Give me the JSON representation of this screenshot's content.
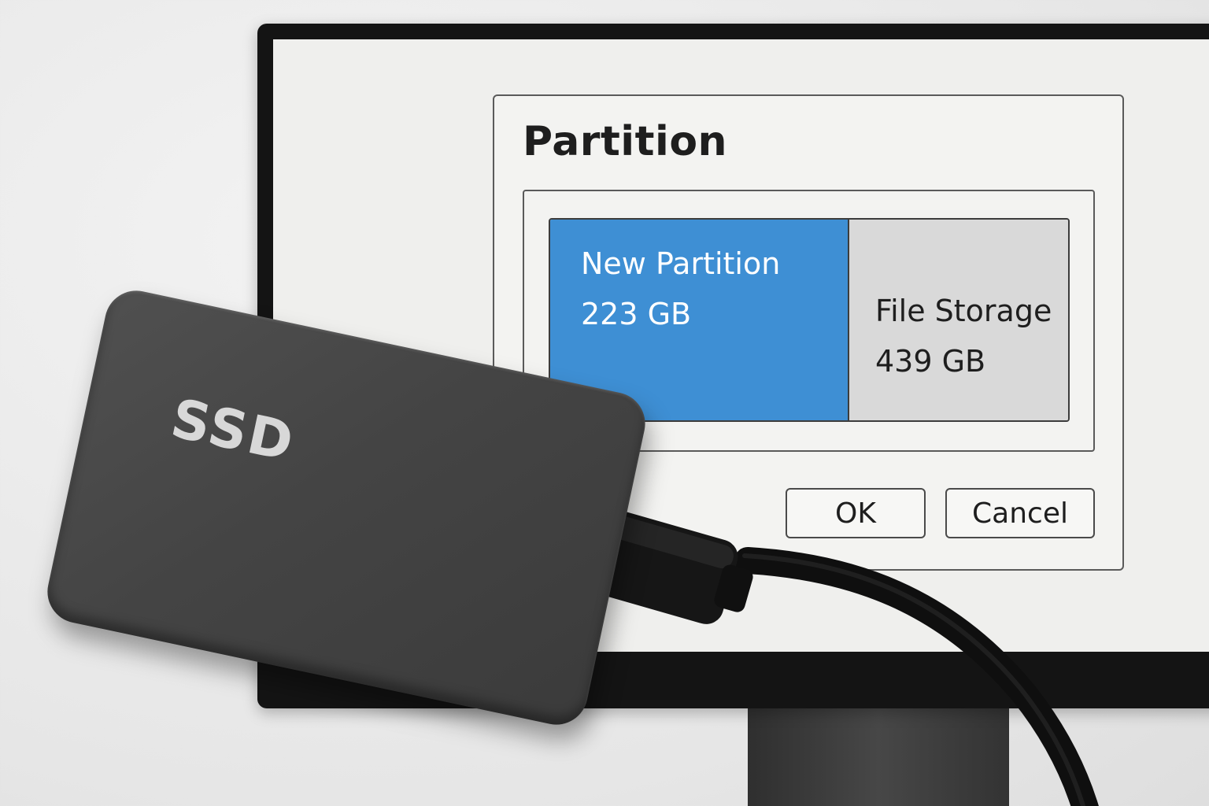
{
  "dialog": {
    "title": "Partition",
    "partitions": [
      {
        "name": "New Partition",
        "size": "223 GB",
        "color": "#3e8fd4",
        "selected": true
      },
      {
        "name": "File Storage",
        "size": "439 GB",
        "color": "#d9d9d9",
        "selected": false
      }
    ],
    "buttons": {
      "ok_label": "OK",
      "cancel_label": "Cancel"
    }
  },
  "device": {
    "label": "SSD",
    "body_color": "#444444"
  }
}
